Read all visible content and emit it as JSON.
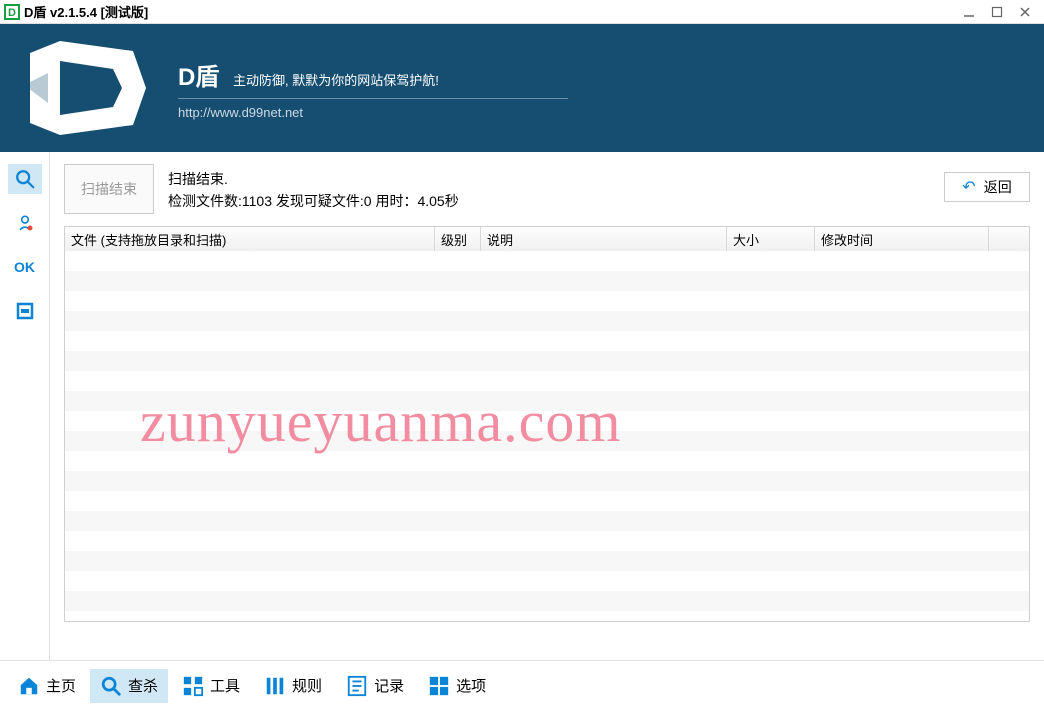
{
  "titlebar": {
    "title": "D盾 v2.1.5.4 [测试版]"
  },
  "banner": {
    "name": "D盾",
    "subtitle": "主动防御, 默默为你的网站保驾护航!",
    "url": "http://www.d99net.net"
  },
  "sidebar": {
    "items": [
      {
        "icon": "search-icon"
      },
      {
        "icon": "fingerprint-icon"
      },
      {
        "icon": "ok-icon",
        "label": "OK"
      },
      {
        "icon": "square-icon"
      }
    ]
  },
  "scan": {
    "button": "扫描结束",
    "status": "扫描结束.",
    "detail": "检测文件数:1103 发现可疑文件:0 用时：4.05秒",
    "return": "返回"
  },
  "table": {
    "columns": {
      "file": "文件 (支持拖放目录和扫描)",
      "level": "级别",
      "desc": "说明",
      "size": "大小",
      "mtime": "修改时间"
    }
  },
  "bottomnav": {
    "items": [
      {
        "label": "主页"
      },
      {
        "label": "查杀"
      },
      {
        "label": "工具"
      },
      {
        "label": "规则"
      },
      {
        "label": "记录"
      },
      {
        "label": "选项"
      }
    ]
  },
  "watermark": "zunyueyuanma.com"
}
